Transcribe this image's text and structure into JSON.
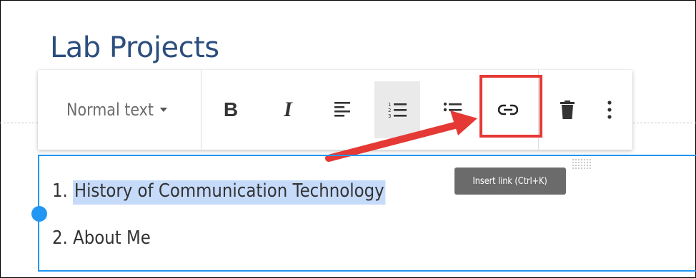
{
  "page": {
    "title": "Lab Projects"
  },
  "toolbar": {
    "text_style": "Normal text",
    "buttons": [
      {
        "name": "bold",
        "label": "B",
        "icon": "bold-icon"
      },
      {
        "name": "italic",
        "label": "I",
        "icon": "italic-icon"
      },
      {
        "name": "align",
        "icon": "align-left-icon"
      },
      {
        "name": "numbered-list",
        "icon": "numbered-list-icon",
        "active": true
      },
      {
        "name": "bulleted-list",
        "icon": "bulleted-list-icon"
      },
      {
        "name": "insert-link",
        "icon": "link-icon",
        "highlighted": true
      },
      {
        "name": "delete",
        "icon": "trash-icon"
      },
      {
        "name": "more",
        "icon": "more-vert-icon"
      }
    ],
    "tooltip": "Insert link (Ctrl+K)"
  },
  "content": {
    "items": [
      {
        "number": "1.",
        "text": "History of Communication Technology",
        "selected": true
      },
      {
        "number": "2.",
        "text": "About Me",
        "selected": false
      }
    ]
  },
  "colors": {
    "title": "#2c4e7e",
    "selection": "#c6dbfa",
    "focus_border": "#2196f3",
    "annotation_red": "#e53935",
    "tooltip_bg": "#6b6b6b"
  }
}
